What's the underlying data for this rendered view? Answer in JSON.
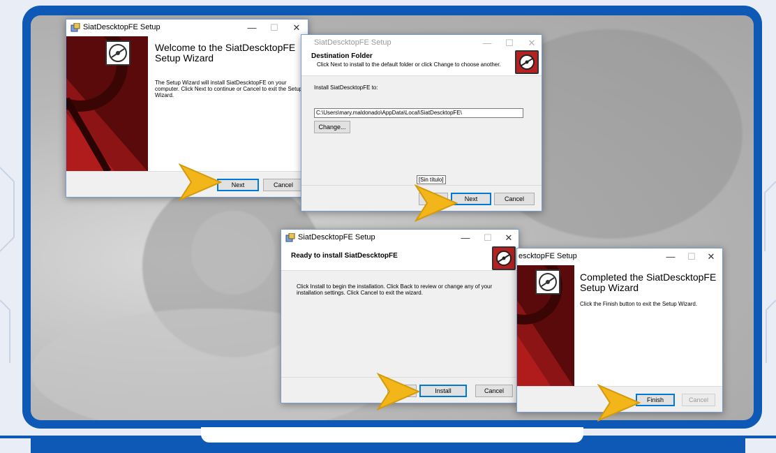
{
  "colors": {
    "frame": "#0e59b5",
    "banner": "#5a0a0a",
    "accent_arrow": "#f2b61a",
    "primary_border": "#0078d7"
  },
  "win1": {
    "title": "SiatDescktopFE Setup",
    "controls": {
      "min": "—",
      "max": "☐",
      "close": "✕"
    },
    "heading": "Welcome to the SiatDescktopFE Setup Wizard",
    "body": "The Setup Wizard will install SiatDescktopFE on your computer. Click Next to continue or Cancel to exit the Setup Wizard.",
    "next_label": "Next",
    "cancel_label": "Cancel",
    "icon": "disc-icon"
  },
  "win2": {
    "title": "SiatDescktopFE Setup",
    "controls": {
      "min": "—",
      "max": "☐",
      "close": "✕"
    },
    "heading": "Destination Folder",
    "subheading": "Click Next to install to the default folder or click Change to choose another.",
    "install_to_label": "Install SiatDescktopFE to:",
    "path_value": "C:\\Users\\mary.maldonado\\AppData\\Local\\SiatDescktopFE\\",
    "change_label": "Change...",
    "tooltip": "[Sin título]",
    "next_label": "Next",
    "cancel_label": "Cancel",
    "icon": "disc-icon"
  },
  "win3": {
    "title": "SiatDescktopFE Setup",
    "controls": {
      "min": "—",
      "max": "☐",
      "close": "✕"
    },
    "heading": "Ready to install SiatDescktopFE",
    "body": "Click Install to begin the installation. Click Back to review or change any of your installation settings. Click Cancel to exit the wizard.",
    "install_label": "Install",
    "cancel_label": "Cancel",
    "icon": "disc-icon"
  },
  "win4": {
    "title": "escktopFE Setup",
    "controls": {
      "min": "—",
      "max": "☐",
      "close": "✕"
    },
    "heading": "Completed the SiatDescktopFE Setup Wizard",
    "body": "Click the Finish button to exit the Setup Wizard.",
    "finish_label": "Finish",
    "cancel_label": "Cancel",
    "icon": "disc-icon"
  }
}
